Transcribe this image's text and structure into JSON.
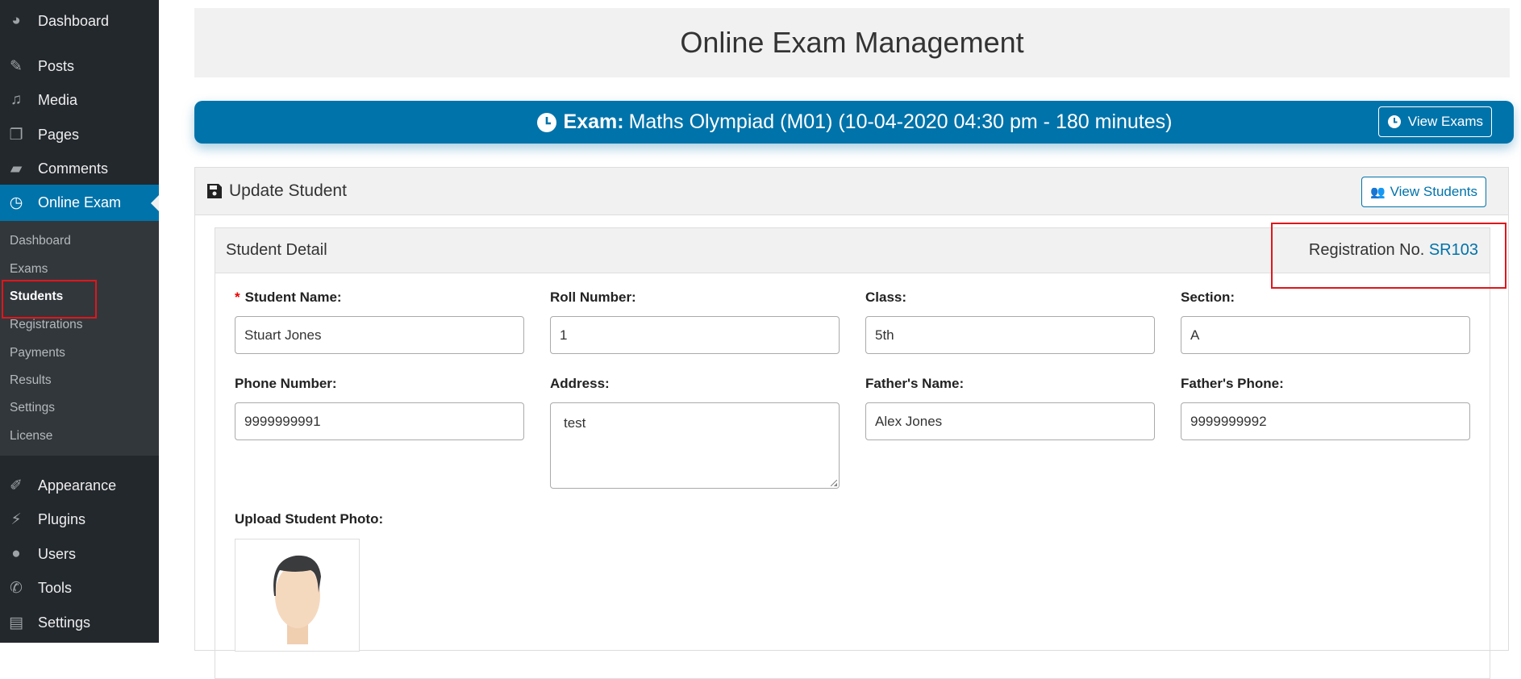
{
  "sidebar": {
    "items": [
      {
        "label": "Dashboard",
        "icon": "dashboard-icon"
      },
      {
        "label": "Posts",
        "icon": "pin-icon"
      },
      {
        "label": "Media",
        "icon": "media-icon"
      },
      {
        "label": "Pages",
        "icon": "pages-icon"
      },
      {
        "label": "Comments",
        "icon": "comment-icon"
      },
      {
        "label": "Online Exam",
        "icon": "clock-icon"
      },
      {
        "label": "Appearance",
        "icon": "brush-icon"
      },
      {
        "label": "Plugins",
        "icon": "plug-icon"
      },
      {
        "label": "Users",
        "icon": "user-icon"
      },
      {
        "label": "Tools",
        "icon": "wrench-icon"
      },
      {
        "label": "Settings",
        "icon": "settings-icon"
      }
    ],
    "submenu": [
      "Dashboard",
      "Exams",
      "Students",
      "Registrations",
      "Payments",
      "Results",
      "Settings",
      "License"
    ]
  },
  "header": {
    "title": "Online Exam Management"
  },
  "exam_bar": {
    "label": "Exam:",
    "text": "Maths Olympiad (M01) (10-04-2020 04:30 pm - 180 minutes)",
    "button": "View Exams"
  },
  "panel": {
    "title": "Update Student",
    "button": "View Students"
  },
  "card": {
    "title": "Student Detail",
    "reg_label": "Registration No.",
    "reg_value": "SR103"
  },
  "form": {
    "fields": [
      {
        "label": "Student Name:",
        "value": "Stuart Jones",
        "required": "*"
      },
      {
        "label": "Roll Number:",
        "value": "1"
      },
      {
        "label": "Class:",
        "value": "5th"
      },
      {
        "label": "Section:",
        "value": "A"
      },
      {
        "label": "Phone Number:",
        "value": "9999999991"
      },
      {
        "label": "Address:",
        "value": "test"
      },
      {
        "label": "Father's Name:",
        "value": "Alex Jones"
      },
      {
        "label": "Father's Phone:",
        "value": "9999999992"
      }
    ],
    "photo_label": "Upload Student Photo:"
  },
  "colors": {
    "accent": "#0073aa",
    "sidebar": "#23282d",
    "highlight": "#e0161c"
  }
}
